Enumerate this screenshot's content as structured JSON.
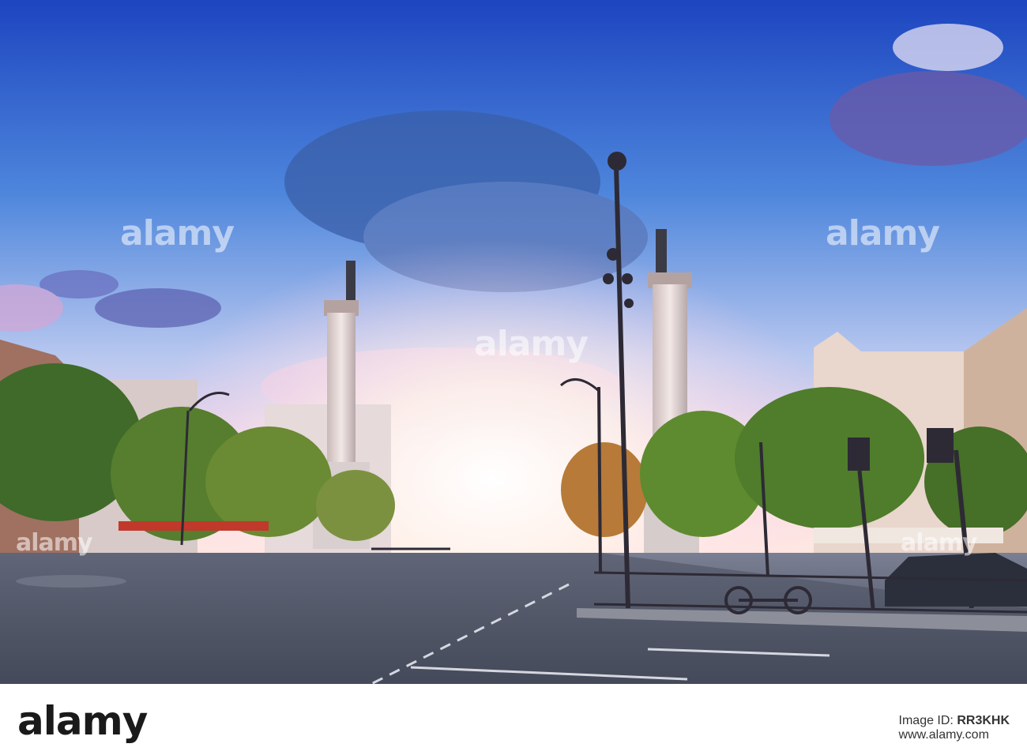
{
  "watermark": {
    "text": "alamy"
  },
  "footer": {
    "brand": "alamy",
    "image_id_prefix": "Image ID: ",
    "image_id": "RR3KHK",
    "url": "www.alamy.com"
  },
  "colors": {
    "sky_top": "#1f4fc8",
    "sky_mid": "#5a8fe0",
    "sun_glow": "#fff6ee",
    "road": "#4a5060",
    "tree": "#3f6a2a"
  }
}
